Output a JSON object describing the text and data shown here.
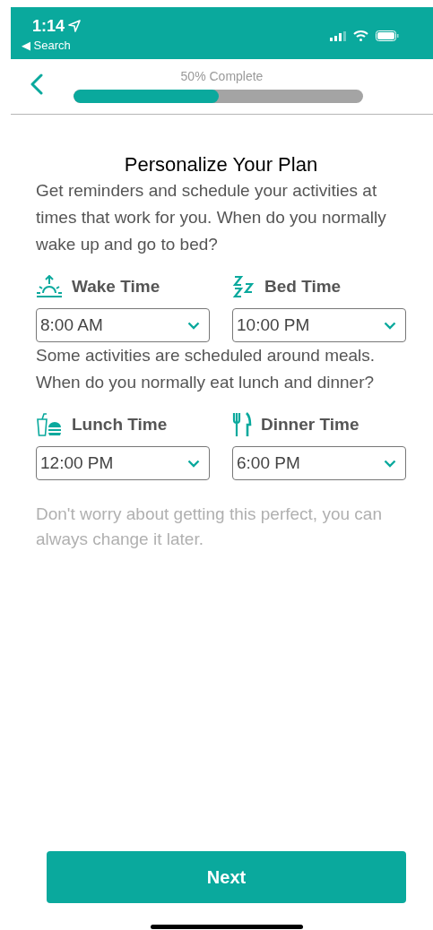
{
  "status_bar": {
    "time": "1:14",
    "back_label": "◀ Search"
  },
  "header": {
    "progress_label": "50% Complete",
    "progress": {
      "level": 0.5
    }
  },
  "title": "Personalize Your Plan",
  "sections": [
    {
      "intro": "Get reminders and schedule your activities at times that work for you. When do you normally wake up and go to bed?",
      "fields": [
        {
          "kind": "wake",
          "label": "Wake Time",
          "value": "8:00 AM"
        },
        {
          "kind": "bed",
          "label": "Bed Time",
          "value": "10:00 PM"
        }
      ]
    },
    {
      "intro": "Some activities are scheduled around meals. When do you normally eat lunch and dinner?",
      "fields": [
        {
          "kind": "lunch",
          "label": "Lunch Time",
          "value": "12:00 PM"
        },
        {
          "kind": "dinner",
          "label": "Dinner Time",
          "value": "6:00 PM"
        }
      ]
    }
  ],
  "note": "Don't worry about getting this perfect, you can always change it later.",
  "next_button": "Next"
}
